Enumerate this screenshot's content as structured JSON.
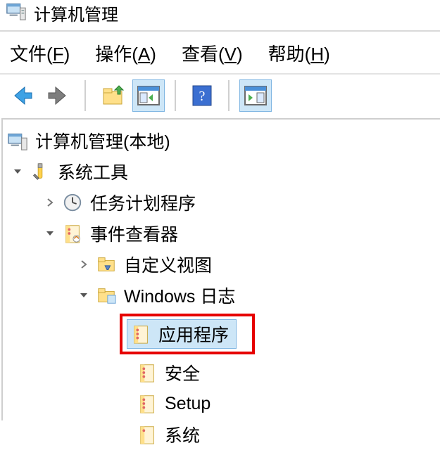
{
  "title": "计算机管理",
  "menu": {
    "file": {
      "label": "文件",
      "accel": "F"
    },
    "action": {
      "label": "操作",
      "accel": "A"
    },
    "view": {
      "label": "查看",
      "accel": "V"
    },
    "help": {
      "label": "帮助",
      "accel": "H"
    }
  },
  "toolbar": {
    "back": "back",
    "forward": "forward",
    "up": "up",
    "show_hide": "show-hide-panel",
    "help": "help",
    "export": "export-list"
  },
  "tree": {
    "root": "计算机管理(本地)",
    "system_tools": "系统工具",
    "task_scheduler": "任务计划程序",
    "event_viewer": "事件查看器",
    "custom_views": "自定义视图",
    "windows_logs": "Windows 日志",
    "application": "应用程序",
    "security": "安全",
    "setup": "Setup",
    "system_partial": "系统"
  }
}
